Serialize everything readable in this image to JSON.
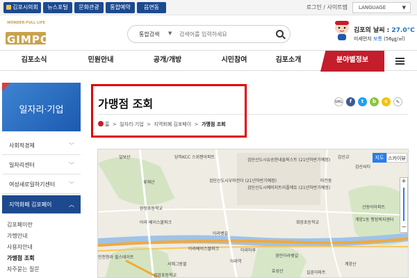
{
  "topbar": {
    "tabs": [
      "김포시의회",
      "뉴스포털",
      "문화관광",
      "통합예약",
      "읍면동"
    ],
    "links": "로그인 / 사이트맵",
    "language": "LANGUAGE"
  },
  "logo": {
    "top_text": "WONDER-FULL LIFE",
    "word": "GIMPO"
  },
  "search": {
    "category": "통합검색",
    "placeholder": "검색어를 입력하세요"
  },
  "weather": {
    "label": "김포의 날씨 : ",
    "temp": "27.0°C",
    "dust_label": "미세먼지 ",
    "dust_level": "보통",
    "dust_value": " (56㎍/㎥)"
  },
  "nav": {
    "items": [
      "김포소식",
      "민원안내",
      "공개/개방",
      "시민참여",
      "김포소개"
    ],
    "highlight": "분야별정보"
  },
  "sidebar": {
    "title": "일자리·기업",
    "menus": [
      "사회적경제",
      "일자리센터",
      "여성새로일하기센터",
      "지역화폐 김포페이"
    ],
    "sub_items": [
      "김포페이란",
      "가맹안내",
      "사용자안내",
      "가맹점 조회",
      "자주묻는 질문"
    ]
  },
  "page": {
    "title": "가맹점 조회",
    "breadcrumbs": [
      "홈",
      "일자리·기업",
      "지역화폐 김포페이",
      "가맹점 조회"
    ]
  },
  "share": [
    "URL",
    "f",
    "t",
    "b",
    "s",
    "✎"
  ],
  "map": {
    "types": [
      "지도",
      "스카이뷰"
    ],
    "labels": [
      "일보산",
      "당하KCC 스위첸아파트",
      "검단신도시유승한내들퍼스트 (21년하반기예정)",
      "검단신도시예미지트리플에듀 (21년하반기예정)",
      "갑산교",
      "감산씨티",
      "마전동",
      "희망초등학교",
      "검단신도시우미린더 (21년하반기예정)",
      "꽃재산",
      "신동아아파트",
      "계양1동 행정복지센터",
      "완정초등학교",
      "아라 베이스볼파크",
      "아라뱃길",
      "아라마루",
      "경인아라뱃길",
      "아라역",
      "효성산",
      "인천청라 힐스테이트",
      "계양산",
      "길훈아파트",
      "아라베이스볼파크",
      "검암초등학교",
      "서해그랑블"
    ]
  }
}
